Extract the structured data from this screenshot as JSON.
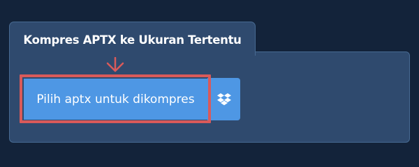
{
  "panel": {
    "title": "Kompres APTX ke Ukuran Tertentu"
  },
  "upload": {
    "button_label": "Pilih aptx untuk dikompres",
    "dropbox_icon": "dropbox-icon"
  },
  "annotation": {
    "arrow_icon": "arrow-down-icon",
    "highlight_color": "#d95a5a"
  },
  "colors": {
    "page_background": "#13233a",
    "panel_background": "#2f4a6e",
    "button_background": "#4e97e4",
    "text": "#ffffff"
  }
}
